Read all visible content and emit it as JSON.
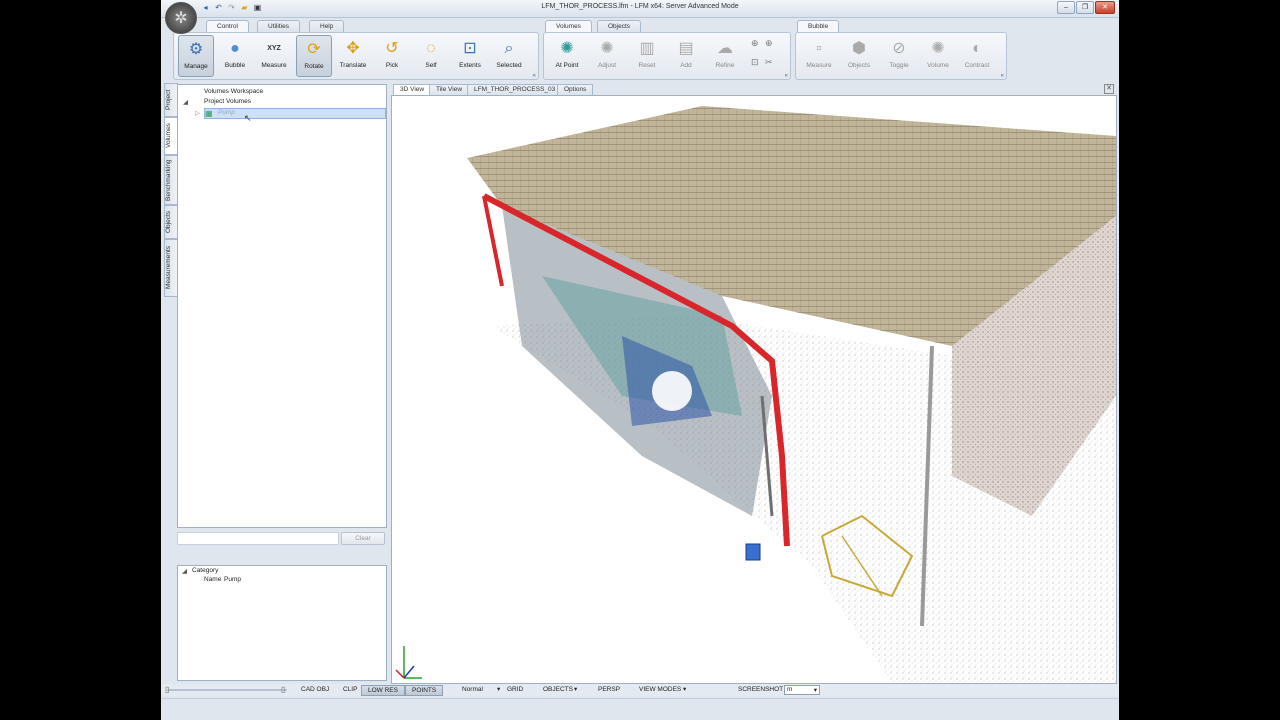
{
  "window": {
    "title": "LFM_THOR_PROCESS.lfm - LFM x64: Server Advanced Mode"
  },
  "ribbon": {
    "tabs_left": [
      "Control",
      "Utilities",
      "Help"
    ],
    "tabs_volumes": [
      "Volumes",
      "Objects"
    ],
    "tabs_bubble": [
      "Bubble"
    ],
    "control_buttons": [
      {
        "label": "Manage",
        "icon": "manage-icon"
      },
      {
        "label": "Bubble",
        "icon": "bubble-icon"
      },
      {
        "label": "Measure",
        "icon": "measure-xyz-icon",
        "glyph": "XYZ"
      },
      {
        "label": "Rotate",
        "icon": "rotate-icon"
      },
      {
        "label": "Translate",
        "icon": "translate-icon"
      },
      {
        "label": "Pick",
        "icon": "pick-icon"
      },
      {
        "label": "Self",
        "icon": "self-icon"
      },
      {
        "label": "Extents",
        "icon": "extents-icon"
      },
      {
        "label": "Selected",
        "icon": "selected-icon"
      }
    ],
    "volume_buttons": [
      {
        "label": "At Point",
        "icon": "at-point-icon"
      },
      {
        "label": "Adjust",
        "icon": "adjust-icon"
      },
      {
        "label": "Reset",
        "icon": "reset-icon"
      },
      {
        "label": "Add",
        "icon": "add-icon"
      },
      {
        "label": "Refine",
        "icon": "refine-icon"
      }
    ],
    "bubble_buttons": [
      {
        "label": "Measure",
        "icon": "bubble-measure-icon"
      },
      {
        "label": "Objects",
        "icon": "bubble-objects-icon"
      },
      {
        "label": "Toggle",
        "icon": "toggle-icon"
      },
      {
        "label": "Volume",
        "icon": "volume-icon"
      },
      {
        "label": "Contrast",
        "icon": "contrast-icon"
      }
    ]
  },
  "side_tabs": [
    "Project",
    "Volumes",
    "Benchmarking",
    "Objects",
    "Measurements"
  ],
  "tree": {
    "root": "Volumes Workspace",
    "child": "Project Volumes",
    "item": "Pump"
  },
  "search": {
    "clear_label": "Clear"
  },
  "properties": {
    "category_label": "Category",
    "name_key": "Name",
    "name_value": "Pump"
  },
  "view_tabs": [
    "3D View",
    "Tile View",
    "LFM_THOR_PROCESS_03",
    "Options"
  ],
  "statusbar": {
    "cad_obj": "CAD OBJ",
    "clip": "CLIP",
    "low_res": "LOW RES",
    "points": "POINTS",
    "render_mode": "Normal",
    "grid": "GRID",
    "objects": "OBJECTS",
    "persp": "PERSP",
    "view_modes": "VIEW MODES",
    "screenshot": "SCREENSHOT",
    "unit": "m"
  },
  "colors": {
    "accent": "#2a5ea8",
    "pipe_red": "#d8262a",
    "selection": "#cde0f5"
  }
}
